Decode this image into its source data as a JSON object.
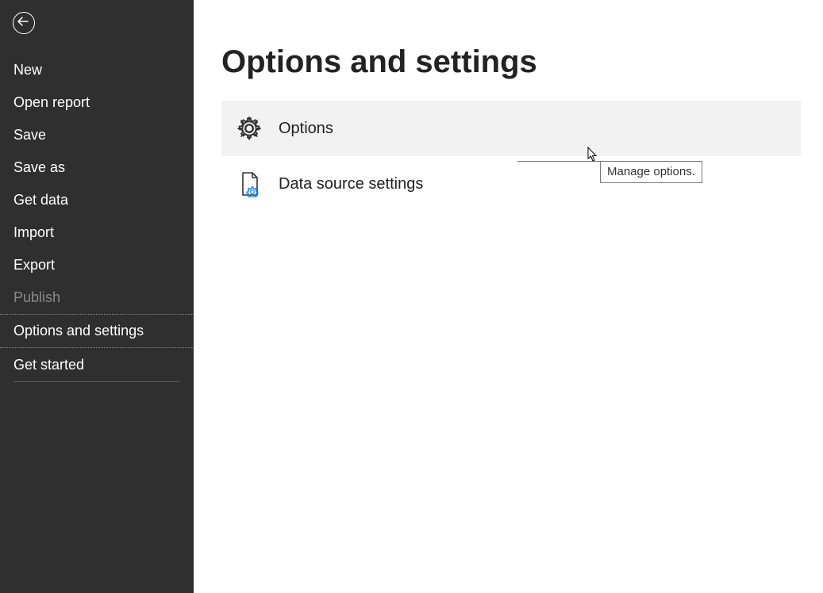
{
  "sidebar": {
    "items": [
      {
        "label": "New"
      },
      {
        "label": "Open report"
      },
      {
        "label": "Save"
      },
      {
        "label": "Save as"
      },
      {
        "label": "Get data"
      },
      {
        "label": "Import"
      },
      {
        "label": "Export"
      },
      {
        "label": "Publish"
      },
      {
        "label": "Options and settings"
      },
      {
        "label": "Get started"
      }
    ]
  },
  "main": {
    "title": "Options and settings",
    "options": [
      {
        "label": "Options"
      },
      {
        "label": "Data source settings"
      }
    ]
  },
  "tooltip": {
    "text": "Manage options."
  }
}
